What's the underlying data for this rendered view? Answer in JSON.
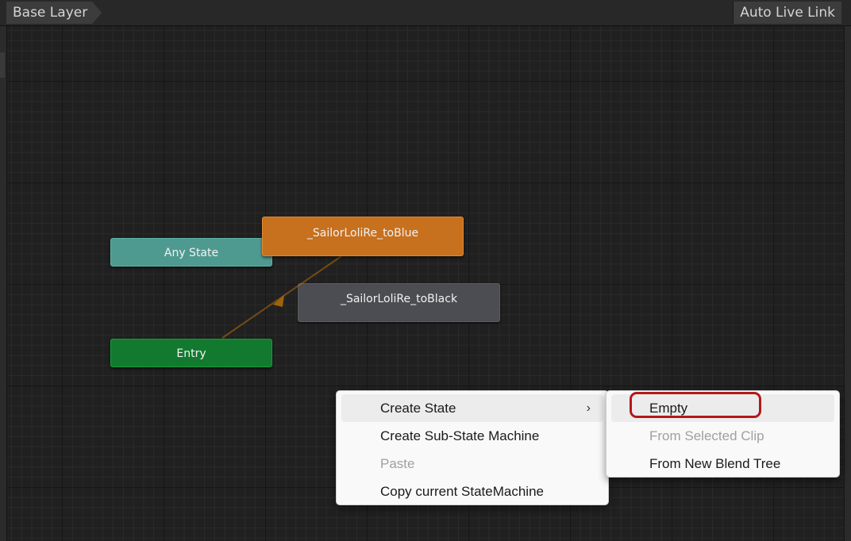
{
  "toolbar": {
    "breadcrumb": "Base Layer",
    "auto_live_link": "Auto Live Link"
  },
  "graph": {
    "nodes": {
      "any_state": "Any State",
      "entry": "Entry",
      "to_blue": "_SailorLoliRe_toBlue",
      "to_black": "_SailorLoliRe_toBlack"
    },
    "colors": {
      "any_state": "#4f9a90",
      "entry": "#127a2f",
      "default_state": "#c7701e",
      "state": "#4b4d52",
      "transition": "#b46e0c"
    }
  },
  "context_menu": {
    "items": [
      {
        "label": "Create State",
        "has_submenu": true,
        "enabled": true
      },
      {
        "label": "Create Sub-State Machine",
        "enabled": true
      },
      {
        "label": "Paste",
        "enabled": false
      },
      {
        "label": "Copy current StateMachine",
        "enabled": true
      }
    ]
  },
  "submenu": {
    "items": [
      {
        "label": "Empty",
        "enabled": true,
        "highlighted": true
      },
      {
        "label": "From Selected Clip",
        "enabled": false
      },
      {
        "label": "From New Blend Tree",
        "enabled": true
      }
    ]
  },
  "icons": {
    "submenu_chevron": "chevron-right-icon"
  }
}
